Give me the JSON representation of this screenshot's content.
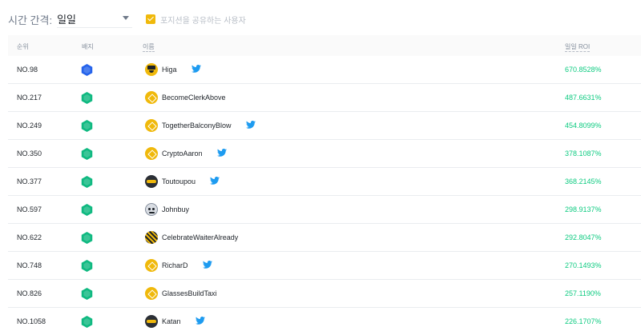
{
  "filters": {
    "interval_label": "시간 간격:",
    "interval_value": "일일",
    "share_label": "포지션을 공유하는 사용자",
    "share_checked": true
  },
  "table": {
    "headers": {
      "rank": "순위",
      "badge": "배지",
      "name": "이름",
      "roi": "일일 ROI"
    },
    "rows": [
      {
        "rank": "NO.98",
        "badge": "blue",
        "avatar": "hat-icon",
        "name": "Higa",
        "twitter": true,
        "roi": "670.8528%"
      },
      {
        "rank": "NO.217",
        "badge": "green",
        "avatar": "binance-avatar-icon",
        "name": "BecomeClerkAbove",
        "twitter": false,
        "roi": "487.6631%"
      },
      {
        "rank": "NO.249",
        "badge": "green",
        "avatar": "binance-avatar-icon",
        "name": "TogetherBalconyBlow",
        "twitter": true,
        "roi": "454.8099%"
      },
      {
        "rank": "NO.350",
        "badge": "green",
        "avatar": "binance-avatar-icon",
        "name": "CryptoAaron",
        "twitter": true,
        "roi": "378.1087%"
      },
      {
        "rank": "NO.377",
        "badge": "green",
        "avatar": "sunglasses-avatar-icon",
        "name": "Toutoupou",
        "twitter": true,
        "roi": "368.2145%"
      },
      {
        "rank": "NO.597",
        "badge": "green",
        "avatar": "face-avatar-icon",
        "name": "Johnbuy",
        "twitter": false,
        "roi": "298.9137%"
      },
      {
        "rank": "NO.622",
        "badge": "green",
        "avatar": "pattern-avatar-icon",
        "name": "CelebrateWaiterAlready",
        "twitter": false,
        "roi": "292.8047%"
      },
      {
        "rank": "NO.748",
        "badge": "green",
        "avatar": "binance-avatar-icon",
        "name": "RicharD",
        "twitter": true,
        "roi": "270.1493%"
      },
      {
        "rank": "NO.826",
        "badge": "green",
        "avatar": "binance-avatar-icon",
        "name": "GlassesBuildTaxi",
        "twitter": false,
        "roi": "257.1190%"
      },
      {
        "rank": "NO.1058",
        "badge": "green",
        "avatar": "sunglasses-avatar-icon",
        "name": "Katan",
        "twitter": true,
        "roi": "226.1707%"
      }
    ]
  },
  "colors": {
    "accent": "#f0b90b",
    "roi_positive": "#0ecb81",
    "badge_green": "#10b981",
    "badge_blue": "#2563eb",
    "twitter": "#1d9bf0"
  }
}
